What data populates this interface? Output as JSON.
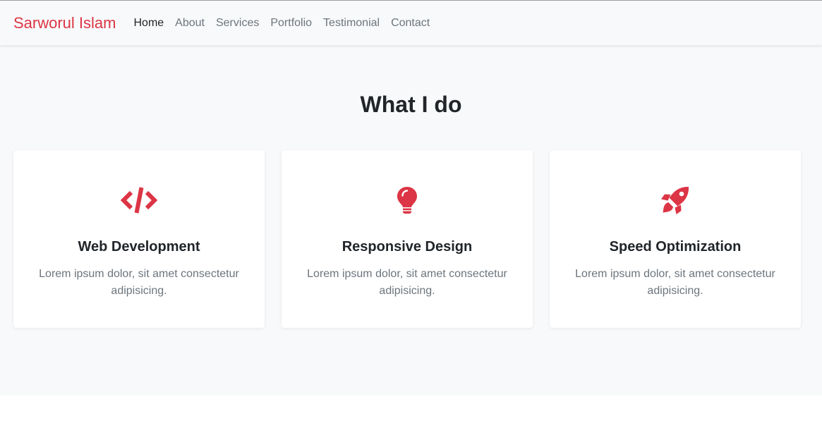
{
  "brand": "Sarworul Islam",
  "nav": {
    "items": [
      {
        "label": "Home"
      },
      {
        "label": "About"
      },
      {
        "label": "Services"
      },
      {
        "label": "Portfolio"
      },
      {
        "label": "Testimonial"
      },
      {
        "label": "Contact"
      }
    ],
    "active": "Home"
  },
  "services": {
    "title": "What I do",
    "cards": [
      {
        "icon": "code-icon",
        "title": "Web Development",
        "text": "Lorem ipsum dolor, sit amet consectetur adipisicing."
      },
      {
        "icon": "lightbulb-icon",
        "title": "Responsive Design",
        "text": "Lorem ipsum dolor, sit amet consectetur adipisicing."
      },
      {
        "icon": "rocket-icon",
        "title": "Speed Optimization",
        "text": "Lorem ipsum dolor, sit amet consectetur adipisicing."
      }
    ]
  },
  "colors": {
    "accent": "#dc3545",
    "section_bg": "#f8f9fa",
    "heading": "#212529",
    "muted": "#6c757d"
  }
}
